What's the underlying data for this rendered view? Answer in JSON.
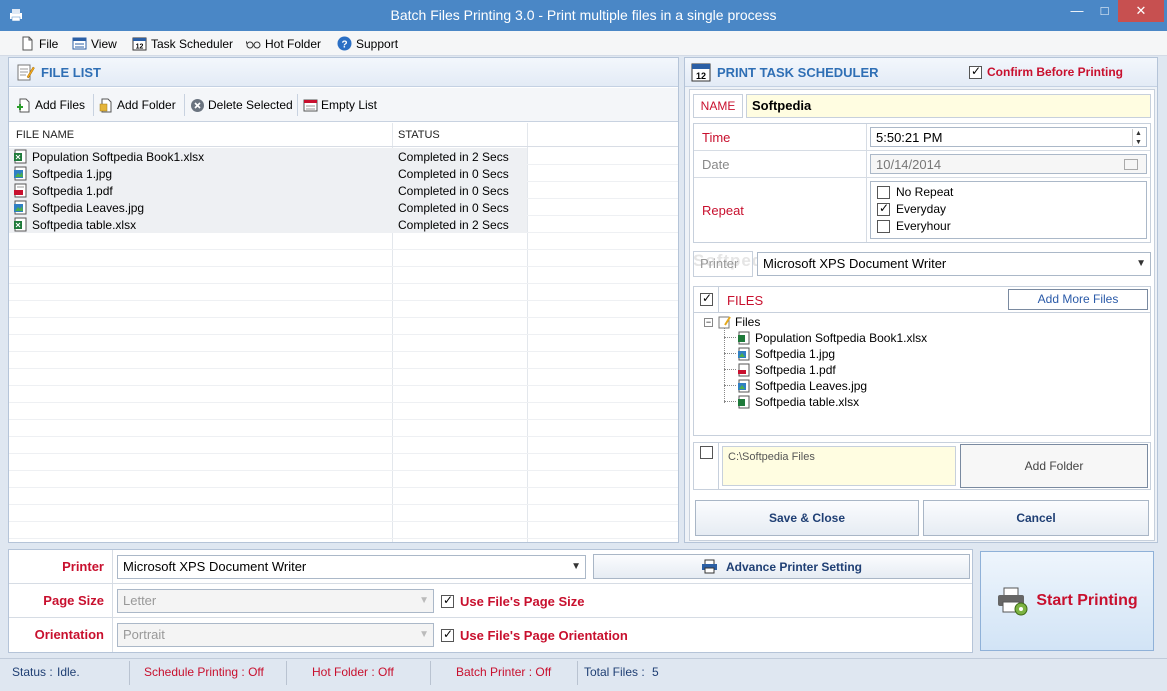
{
  "window": {
    "title": "Batch Files Printing 3.0 - Print multiple files in a single process",
    "min": "—",
    "max": "□",
    "close": "✕"
  },
  "menu": [
    {
      "label": "File",
      "icon": "file-icon"
    },
    {
      "label": "View",
      "icon": "view-icon"
    },
    {
      "label": "Task Scheduler",
      "icon": "calendar-icon"
    },
    {
      "label": "Hot Folder",
      "icon": "glasses-icon"
    },
    {
      "label": "Support",
      "icon": "help-icon"
    }
  ],
  "file_list": {
    "title": "FILE LIST",
    "toolbar": {
      "add_files": "Add Files",
      "add_folder": "Add Folder",
      "delete_selected": "Delete Selected",
      "empty_list": "Empty List"
    },
    "columns": {
      "name": "FILE NAME",
      "status": "STATUS"
    },
    "rows": [
      {
        "name": "Population Softpedia Book1.xlsx",
        "status": "Completed in 2 Secs",
        "type": "xlsx"
      },
      {
        "name": "Softpedia 1.jpg",
        "status": "Completed in 0 Secs",
        "type": "jpg"
      },
      {
        "name": "Softpedia 1.pdf",
        "status": "Completed in 0 Secs",
        "type": "pdf"
      },
      {
        "name": "Softpedia Leaves.jpg",
        "status": "Completed in 0 Secs",
        "type": "jpg"
      },
      {
        "name": "Softpedia table.xlsx",
        "status": "Completed in 2 Secs",
        "type": "xlsx"
      }
    ]
  },
  "scheduler": {
    "title": "PRINT TASK SCHEDULER",
    "confirm_label": "Confirm Before Printing",
    "confirm_checked": true,
    "name_label": "NAME",
    "name_value": "Softpedia",
    "time_label": "Time",
    "time_value": "5:50:21 PM",
    "date_label": "Date",
    "date_value": "10/14/2014",
    "repeat_label": "Repeat",
    "repeat_options": [
      {
        "label": "No Repeat",
        "checked": false
      },
      {
        "label": "Everyday",
        "checked": true
      },
      {
        "label": "Everyhour",
        "checked": false
      }
    ],
    "printer_label": "Printer",
    "printer_value": "Microsoft XPS Document Writer",
    "watermark": "Softpedia",
    "files_label": "FILES",
    "add_more_files": "Add More Files",
    "tree_root": "Files",
    "tree_files": [
      {
        "name": "Population Softpedia Book1.xlsx",
        "type": "xlsx"
      },
      {
        "name": "Softpedia 1.jpg",
        "type": "jpg"
      },
      {
        "name": "Softpedia 1.pdf",
        "type": "pdf"
      },
      {
        "name": "Softpedia Leaves.jpg",
        "type": "jpg"
      },
      {
        "name": "Softpedia table.xlsx",
        "type": "xlsx"
      }
    ],
    "folder_path": "C:\\Softpedia Files",
    "add_folder": "Add Folder",
    "save_close": "Save & Close",
    "cancel": "Cancel"
  },
  "settings": {
    "printer_label": "Printer",
    "printer_value": "Microsoft XPS Document Writer",
    "advance_printer": "Advance Printer Setting",
    "page_size_label": "Page Size",
    "page_size_value": "Letter",
    "use_page_size": "Use File's Page Size",
    "orientation_label": "Orientation",
    "orientation_value": "Portrait",
    "use_orientation": "Use File's Page Orientation"
  },
  "start_printing": "Start Printing",
  "status": {
    "status_label": "Status :",
    "status_value": "Idle.",
    "schedule": "Schedule Printing : Off",
    "hot_folder": "Hot Folder : Off",
    "batch_printer": "Batch Printer : Off",
    "total_label": "Total Files :",
    "total_value": "5"
  },
  "colors": {
    "titlebar": "#4a87c6",
    "accent_red": "#c8102e",
    "header_blue": "#2f6fb5",
    "highlight_yellow": "#fffde1"
  }
}
